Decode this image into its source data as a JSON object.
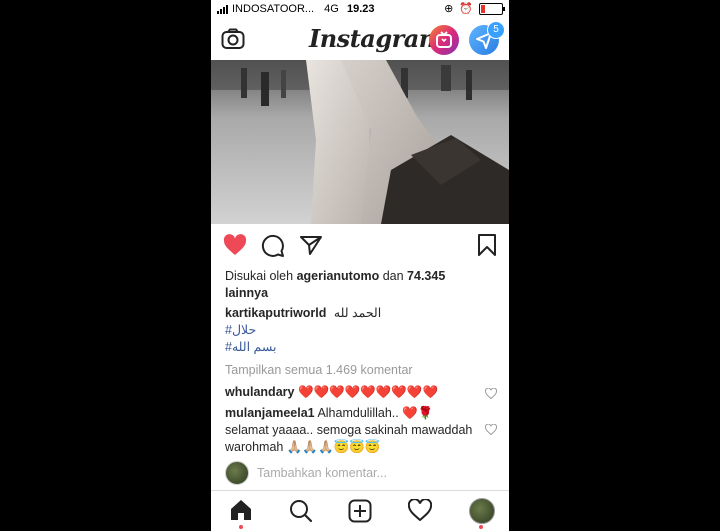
{
  "status_bar": {
    "carrier": "INDOSATOOR...",
    "network": "4G",
    "time": "19.23"
  },
  "header": {
    "app_title": "Instagram",
    "dm_badge_count": "5",
    "icons": [
      "camera-icon",
      "igtv-icon",
      "direct-message-icon"
    ]
  },
  "post": {
    "liked_prefix": "Disukai oleh ",
    "liked_user": "agerianutomo",
    "liked_mid": " dan ",
    "liked_count": "74.345",
    "liked_suffix": "lainnya",
    "author": "kartikaputriworld",
    "caption": "الحمد لله",
    "hashtag1": "#حلال",
    "hashtag2": "#بسم الله",
    "view_all_comments": "Tampilkan semua 1.469 komentar",
    "comments": [
      {
        "user": "whulandary",
        "text": "❤️❤️❤️❤️❤️❤️❤️❤️❤️"
      },
      {
        "user": "mulanjameela1",
        "text": "Alhamdulillah.. ❤️🌹 selamat yaaaa.. semoga sakinah mawaddah warohmah 🙏🏼🙏🏼🙏🏼😇😇😇"
      }
    ],
    "add_comment_placeholder": "Tambahkan komentar..."
  },
  "colors": {
    "like": "#ed4956",
    "link": "#385898",
    "notification_dot": "#ed4956"
  },
  "tab_bar": {
    "icons": [
      "home-icon",
      "search-icon",
      "new-post-icon",
      "activity-icon",
      "profile-icon"
    ]
  }
}
